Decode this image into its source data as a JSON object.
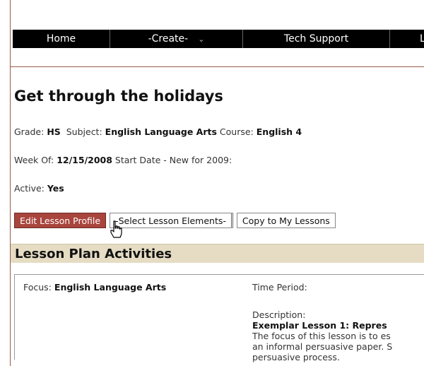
{
  "nav": {
    "items": [
      {
        "label": "Home"
      },
      {
        "label": "-Create-"
      },
      {
        "label": "Tech Support"
      },
      {
        "label": "L"
      }
    ]
  },
  "lesson": {
    "title": "Get through the holidays",
    "grade_label": "Grade:",
    "grade": "HS",
    "subject_label": "Subject:",
    "subject": "English Language Arts",
    "course_label": "Course:",
    "course": "English 4",
    "week_label": "Week Of:",
    "week": "12/15/2008",
    "start_label": "Start Date - New for 2009:",
    "active_label": "Active:",
    "active": "Yes"
  },
  "tabs": [
    {
      "label": "Edit Lesson Profile"
    },
    {
      "label": "-Select Lesson Elements-"
    },
    {
      "label": "Copy to My Lessons"
    }
  ],
  "section": {
    "title": "Lesson Plan Activities"
  },
  "activity": {
    "focus_label": "Focus:",
    "focus": "English Language Arts",
    "time_label": "Time Period:",
    "desc_label": "Description:",
    "desc_lead": "Exemplar Lesson 1: Repres",
    "desc_line1": "The focus of this lesson is to es",
    "desc_line2": "an informal persuasive paper. S",
    "desc_line3": "persuasive process."
  },
  "colors": {
    "nav_bg": "#000000",
    "tab_active": "#a8453d",
    "section_bg": "#e5dcc3"
  }
}
